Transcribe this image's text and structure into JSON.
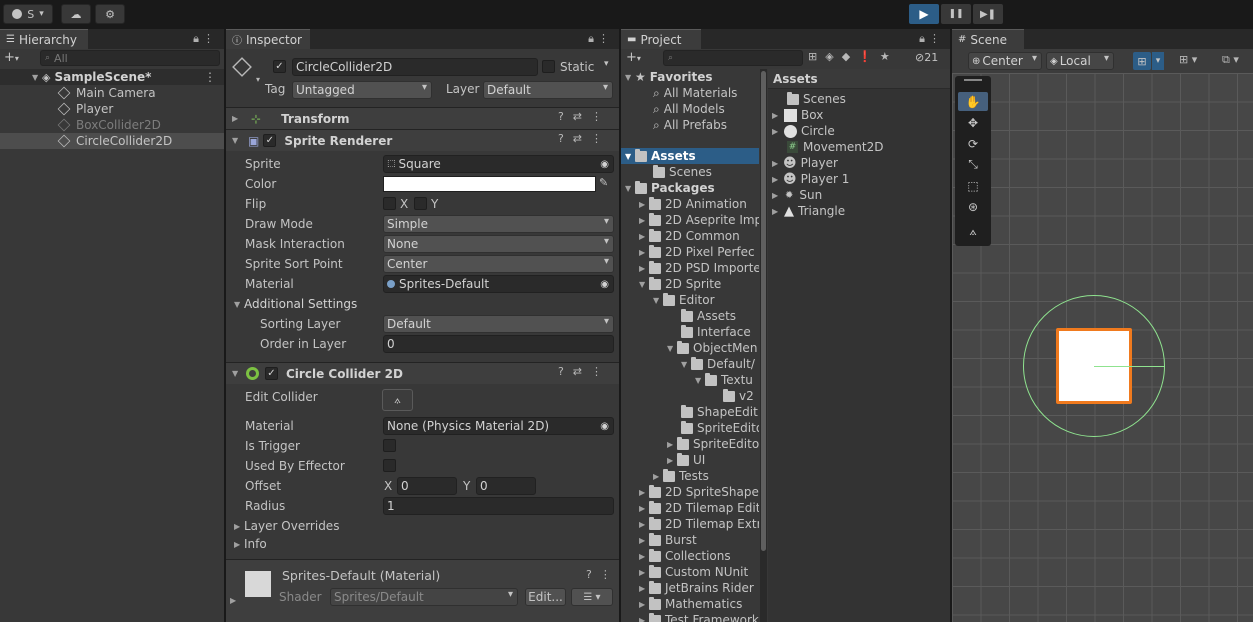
{
  "toolbar": {
    "account_label": "S",
    "play_label": "▶",
    "pause_label": "❚❚",
    "step_label": "▶❚"
  },
  "hierarchy": {
    "tab_label": "Hierarchy",
    "add_label": "+",
    "search_placeholder": "All",
    "scene_name": "SampleScene*",
    "items": [
      {
        "label": "Main Camera"
      },
      {
        "label": "Player"
      },
      {
        "label": "BoxCollider2D"
      },
      {
        "label": "CircleCollider2D"
      }
    ]
  },
  "inspector": {
    "tab_label": "Inspector",
    "object_name": "CircleCollider2D",
    "static_label": "Static",
    "tag_label": "Tag",
    "tag_value": "Untagged",
    "layer_label": "Layer",
    "layer_value": "Default",
    "transform_label": "Transform",
    "sprite_renderer": {
      "title": "Sprite Renderer",
      "sprite_label": "Sprite",
      "sprite_value": "Square",
      "color_label": "Color",
      "color_value": "#ffffff",
      "flip_label": "Flip",
      "flip_x": "X",
      "flip_y": "Y",
      "draw_mode_label": "Draw Mode",
      "draw_mode_value": "Simple",
      "mask_label": "Mask Interaction",
      "mask_value": "None",
      "sort_point_label": "Sprite Sort Point",
      "sort_point_value": "Center",
      "material_label": "Material",
      "material_value": "Sprites-Default",
      "additional_label": "Additional Settings",
      "sorting_layer_label": "Sorting Layer",
      "sorting_layer_value": "Default",
      "order_label": "Order in Layer",
      "order_value": "0"
    },
    "circle_collider": {
      "title": "Circle Collider 2D",
      "edit_label": "Edit Collider",
      "material_label": "Material",
      "material_value": "None (Physics Material 2D)",
      "trigger_label": "Is Trigger",
      "effector_label": "Used By Effector",
      "offset_label": "Offset",
      "offset_x_label": "X",
      "offset_x": "0",
      "offset_y_label": "Y",
      "offset_y": "0",
      "radius_label": "Radius",
      "radius_value": "1",
      "overrides_label": "Layer Overrides",
      "info_label": "Info"
    },
    "material_preview": {
      "name": "Sprites-Default (Material)",
      "shader_label": "Shader",
      "shader_value": "Sprites/Default",
      "edit_label": "Edit..."
    }
  },
  "project": {
    "tab_label": "Project",
    "add_label": "+",
    "hidden_count": "21",
    "favorites_label": "Favorites",
    "favorites": [
      {
        "label": "All Materials"
      },
      {
        "label": "All Models"
      },
      {
        "label": "All Prefabs"
      }
    ],
    "tree": [
      {
        "label": "Assets"
      },
      {
        "label": "Scenes"
      },
      {
        "label": "Packages"
      },
      {
        "label": "2D Animation"
      },
      {
        "label": "2D Aseprite Imp"
      },
      {
        "label": "2D Common"
      },
      {
        "label": "2D Pixel Perfec"
      },
      {
        "label": "2D PSD Importe"
      },
      {
        "label": "2D Sprite"
      },
      {
        "label": "Editor"
      },
      {
        "label": "Assets"
      },
      {
        "label": "Interface"
      },
      {
        "label": "ObjectMen"
      },
      {
        "label": "Default/"
      },
      {
        "label": "Textu"
      },
      {
        "label": "v2"
      },
      {
        "label": "ShapeEdit"
      },
      {
        "label": "SpriteEdito"
      },
      {
        "label": "SpriteEdito"
      },
      {
        "label": "UI"
      },
      {
        "label": "Tests"
      },
      {
        "label": "2D SpriteShape"
      },
      {
        "label": "2D Tilemap Edit"
      },
      {
        "label": "2D Tilemap Extr"
      },
      {
        "label": "Burst"
      },
      {
        "label": "Collections"
      },
      {
        "label": "Custom NUnit"
      },
      {
        "label": "JetBrains Rider"
      },
      {
        "label": "Mathematics"
      },
      {
        "label": "Test Framework"
      }
    ],
    "assets_header": "Assets",
    "assets": [
      {
        "label": "Scenes",
        "icon": "folder-icon"
      },
      {
        "label": "Box",
        "icon": "square-sprite-icon"
      },
      {
        "label": "Circle",
        "icon": "circle-sprite-icon"
      },
      {
        "label": "Movement2D",
        "icon": "script-icon"
      },
      {
        "label": "Player",
        "icon": "smiley-sprite-icon"
      },
      {
        "label": "Player 1",
        "icon": "smiley-sprite-icon"
      },
      {
        "label": "Sun",
        "icon": "sun-sprite-icon"
      },
      {
        "label": "Triangle",
        "icon": "triangle-sprite-icon"
      }
    ]
  },
  "scene": {
    "tab_label": "Scene",
    "pivot_label": "Center",
    "space_label": "Local"
  },
  "colors": {
    "accent": "#2c5d87",
    "collider_outline": "#8fe38f",
    "selection_outline": "#f07a1e"
  }
}
